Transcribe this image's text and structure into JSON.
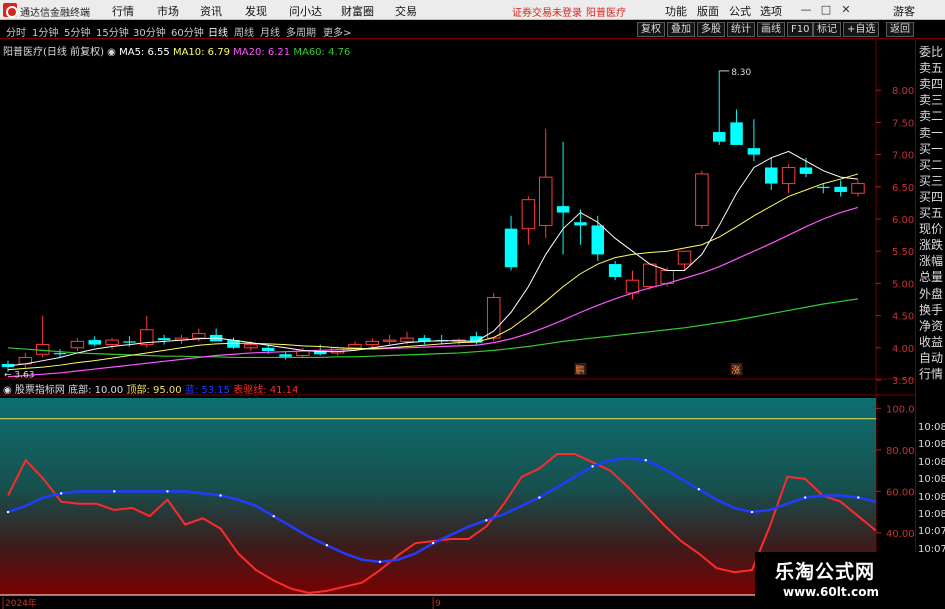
{
  "app": {
    "name": "通达信金融终端"
  },
  "menu": [
    "行情",
    "市场",
    "资讯",
    "发现",
    "问小达",
    "财富圈",
    "交易"
  ],
  "notice": {
    "login": "证券交易未登录",
    "stock": "阳普医疗"
  },
  "right_tools": [
    "功能",
    "版面",
    "公式",
    "选项"
  ],
  "window": {
    "min": "—",
    "max": "□",
    "close": "✕",
    "extra": "游客"
  },
  "periods": [
    "分时",
    "1分钟",
    "5分钟",
    "15分钟",
    "30分钟",
    "60分钟",
    "日线",
    "周线",
    "月线",
    "多周期",
    "更多>"
  ],
  "active_period": "日线",
  "tools": [
    "复权",
    "叠加",
    "多股",
    "统计",
    "画线",
    "F10",
    "标记",
    "+自选",
    "返回"
  ],
  "main_legend": {
    "title": "阳普医疗(日线 前复权)",
    "ma5": "MA5: 6.55",
    "ma10": "MA10: 6.79",
    "ma20": "MA20: 6.21",
    "ma60": "MA60: 4.76"
  },
  "indicator_legend": {
    "name": "股票指标网",
    "bottom": "底部: 10.00",
    "top": "顶部: 95.00",
    "blue": "蓝: 53.15",
    "red": "表驱线: 41.14"
  },
  "price_axis": [
    "8.00",
    "7.50",
    "7.00",
    "6.50",
    "6.00",
    "5.50",
    "5.00",
    "4.50",
    "4.00",
    "3.50"
  ],
  "indicator_axis": [
    "100.0",
    "80.00",
    "60.00",
    "40.00"
  ],
  "annotations": {
    "high": "8.30",
    "low": "3.63",
    "mark1": "鹏",
    "mark2": "涨"
  },
  "dates": {
    "d1": "2024年",
    "d2": "9",
    "d3": "10"
  },
  "side_panel": [
    "委比",
    "卖五",
    "卖四",
    "卖三",
    "卖二",
    "卖一",
    "买一",
    "买二",
    "买三",
    "买四",
    "买五",
    "现价",
    "涨跌",
    "涨幅",
    "总量",
    "外盘",
    "换手",
    "净资",
    "收益",
    "自动",
    "行情"
  ],
  "side_times": [
    "10:08",
    "10:08",
    "10:08",
    "10:08",
    "10:08",
    "10:08",
    "10:07",
    "10:07",
    "10:07"
  ],
  "watermark": {
    "title": "乐淘公式网",
    "url": "www.60lt.com"
  },
  "colors": {
    "up": "#ff3c3c",
    "down": "#00ffff",
    "ma5": "#ffffff",
    "ma10": "#ffff66",
    "ma20": "#ff55ff",
    "ma60": "#33cc33",
    "blue_line": "#1f3cff",
    "red_line": "#ff2a2a",
    "yellow_line": "#f0e060"
  },
  "chart_data": {
    "type": "candlestick",
    "ylim": [
      3.5,
      8.5
    ],
    "candles": [
      {
        "o": 3.75,
        "h": 3.8,
        "l": 3.63,
        "c": 3.7
      },
      {
        "o": 3.75,
        "h": 3.92,
        "l": 3.68,
        "c": 3.85
      },
      {
        "o": 3.9,
        "h": 4.5,
        "l": 3.85,
        "c": 4.05
      },
      {
        "o": 3.92,
        "h": 3.98,
        "l": 3.85,
        "c": 3.9
      },
      {
        "o": 4.0,
        "h": 4.15,
        "l": 3.95,
        "c": 4.1
      },
      {
        "o": 4.12,
        "h": 4.18,
        "l": 4.02,
        "c": 4.05
      },
      {
        "o": 4.05,
        "h": 4.15,
        "l": 3.98,
        "c": 4.12
      },
      {
        "o": 4.1,
        "h": 4.18,
        "l": 4.02,
        "c": 4.08
      },
      {
        "o": 4.05,
        "h": 4.5,
        "l": 4.0,
        "c": 4.28
      },
      {
        "o": 4.15,
        "h": 4.2,
        "l": 4.05,
        "c": 4.12
      },
      {
        "o": 4.12,
        "h": 4.2,
        "l": 4.06,
        "c": 4.15
      },
      {
        "o": 4.15,
        "h": 4.3,
        "l": 4.1,
        "c": 4.22
      },
      {
        "o": 4.2,
        "h": 4.3,
        "l": 4.1,
        "c": 4.1
      },
      {
        "o": 4.12,
        "h": 4.16,
        "l": 3.98,
        "c": 4.0
      },
      {
        "o": 4.0,
        "h": 4.1,
        "l": 3.95,
        "c": 4.05
      },
      {
        "o": 4.0,
        "h": 4.05,
        "l": 3.9,
        "c": 3.95
      },
      {
        "o": 3.9,
        "h": 3.95,
        "l": 3.82,
        "c": 3.86
      },
      {
        "o": 3.88,
        "h": 4.0,
        "l": 3.84,
        "c": 3.95
      },
      {
        "o": 3.95,
        "h": 4.05,
        "l": 3.88,
        "c": 3.9
      },
      {
        "o": 3.92,
        "h": 4.02,
        "l": 3.88,
        "c": 4.0
      },
      {
        "o": 4.0,
        "h": 4.1,
        "l": 3.95,
        "c": 4.05
      },
      {
        "o": 4.05,
        "h": 4.15,
        "l": 4.0,
        "c": 4.1
      },
      {
        "o": 4.1,
        "h": 4.2,
        "l": 4.05,
        "c": 4.12
      },
      {
        "o": 4.1,
        "h": 4.25,
        "l": 4.05,
        "c": 4.15
      },
      {
        "o": 4.15,
        "h": 4.2,
        "l": 4.05,
        "c": 4.1
      },
      {
        "o": 4.12,
        "h": 4.2,
        "l": 4.05,
        "c": 4.1
      },
      {
        "o": 4.1,
        "h": 4.15,
        "l": 4.05,
        "c": 4.12
      },
      {
        "o": 4.18,
        "h": 4.25,
        "l": 4.05,
        "c": 4.08
      },
      {
        "o": 4.15,
        "h": 4.85,
        "l": 4.1,
        "c": 4.78
      },
      {
        "o": 5.85,
        "h": 6.05,
        "l": 5.2,
        "c": 5.25
      },
      {
        "o": 5.85,
        "h": 6.35,
        "l": 5.6,
        "c": 6.3
      },
      {
        "o": 5.9,
        "h": 7.4,
        "l": 5.7,
        "c": 6.65
      },
      {
        "o": 6.2,
        "h": 7.2,
        "l": 5.45,
        "c": 6.1
      },
      {
        "o": 5.95,
        "h": 6.15,
        "l": 5.6,
        "c": 5.9
      },
      {
        "o": 5.9,
        "h": 6.05,
        "l": 5.35,
        "c": 5.45
      },
      {
        "o": 5.3,
        "h": 5.35,
        "l": 5.05,
        "c": 5.1
      },
      {
        "o": 4.85,
        "h": 5.2,
        "l": 4.75,
        "c": 5.05
      },
      {
        "o": 4.95,
        "h": 5.3,
        "l": 4.9,
        "c": 5.3
      },
      {
        "o": 5.0,
        "h": 5.25,
        "l": 4.95,
        "c": 5.2
      },
      {
        "o": 5.3,
        "h": 5.5,
        "l": 5.2,
        "c": 5.5
      },
      {
        "o": 5.9,
        "h": 6.75,
        "l": 5.85,
        "c": 6.7
      },
      {
        "o": 7.35,
        "h": 8.3,
        "l": 7.15,
        "c": 7.2
      },
      {
        "o": 7.5,
        "h": 7.7,
        "l": 7.15,
        "c": 7.15
      },
      {
        "o": 7.1,
        "h": 7.55,
        "l": 6.9,
        "c": 7.0
      },
      {
        "o": 6.8,
        "h": 6.95,
        "l": 6.45,
        "c": 6.55
      },
      {
        "o": 6.55,
        "h": 6.85,
        "l": 6.4,
        "c": 6.8
      },
      {
        "o": 6.8,
        "h": 6.95,
        "l": 6.65,
        "c": 6.7
      },
      {
        "o": 6.5,
        "h": 6.55,
        "l": 6.4,
        "c": 6.48
      },
      {
        "o": 6.5,
        "h": 6.6,
        "l": 6.35,
        "c": 6.42
      },
      {
        "o": 6.4,
        "h": 6.6,
        "l": 6.35,
        "c": 6.55
      }
    ],
    "ma5": [
      3.72,
      3.75,
      3.8,
      3.85,
      3.92,
      3.98,
      4.02,
      4.05,
      4.08,
      4.1,
      4.12,
      4.14,
      4.15,
      4.12,
      4.08,
      4.04,
      4.0,
      3.96,
      3.94,
      3.94,
      3.96,
      4.0,
      4.04,
      4.08,
      4.1,
      4.11,
      4.11,
      4.1,
      4.26,
      4.55,
      4.95,
      5.45,
      5.85,
      6.1,
      5.95,
      5.7,
      5.5,
      5.3,
      5.2,
      5.2,
      5.45,
      5.9,
      6.4,
      6.8,
      6.95,
      7.05,
      6.9,
      6.75,
      6.65,
      6.62
    ],
    "ma10": [
      3.66,
      3.68,
      3.7,
      3.73,
      3.77,
      3.8,
      3.84,
      3.88,
      3.92,
      3.96,
      4.0,
      4.04,
      4.06,
      4.07,
      4.07,
      4.06,
      4.05,
      4.03,
      4.02,
      4.0,
      3.99,
      3.99,
      4.0,
      4.02,
      4.04,
      4.06,
      4.08,
      4.09,
      4.16,
      4.3,
      4.5,
      4.72,
      4.95,
      5.15,
      5.3,
      5.4,
      5.45,
      5.48,
      5.5,
      5.55,
      5.6,
      5.72,
      5.88,
      6.05,
      6.2,
      6.35,
      6.45,
      6.55,
      6.62,
      6.7
    ],
    "ma20": [
      3.55,
      3.57,
      3.59,
      3.61,
      3.64,
      3.67,
      3.7,
      3.73,
      3.76,
      3.79,
      3.82,
      3.85,
      3.88,
      3.9,
      3.92,
      3.93,
      3.94,
      3.95,
      3.96,
      3.97,
      3.98,
      3.98,
      3.99,
      4.0,
      4.01,
      4.02,
      4.03,
      4.04,
      4.08,
      4.14,
      4.22,
      4.32,
      4.43,
      4.55,
      4.66,
      4.76,
      4.85,
      4.93,
      5.0,
      5.08,
      5.16,
      5.26,
      5.38,
      5.5,
      5.62,
      5.75,
      5.88,
      6.0,
      6.1,
      6.18
    ],
    "ma60": [
      4.0,
      3.98,
      3.96,
      3.94,
      3.92,
      3.91,
      3.9,
      3.89,
      3.88,
      3.87,
      3.87,
      3.86,
      3.86,
      3.85,
      3.85,
      3.85,
      3.85,
      3.85,
      3.85,
      3.86,
      3.86,
      3.87,
      3.88,
      3.89,
      3.9,
      3.91,
      3.92,
      3.94,
      3.96,
      3.99,
      4.02,
      4.06,
      4.1,
      4.13,
      4.16,
      4.19,
      4.22,
      4.25,
      4.28,
      4.31,
      4.35,
      4.39,
      4.43,
      4.48,
      4.53,
      4.58,
      4.63,
      4.68,
      4.72,
      4.76
    ],
    "indicator": {
      "ylim": [
        10,
        105
      ],
      "bottom": 10,
      "top": 95,
      "blue": [
        50,
        53,
        57,
        59,
        60,
        60,
        60,
        60,
        60,
        60,
        60,
        59,
        58,
        56,
        53,
        48,
        43,
        38,
        34,
        30,
        27,
        26,
        27,
        30,
        35,
        39,
        43,
        46,
        49,
        53,
        57,
        62,
        67,
        72,
        75,
        76,
        75,
        71,
        66,
        61,
        56,
        52,
        50,
        51,
        54,
        57,
        58,
        58,
        57,
        55
      ],
      "red": [
        58,
        75,
        66,
        55,
        54,
        54,
        51,
        52,
        48,
        56,
        44,
        47,
        42,
        30,
        22,
        17,
        13,
        11,
        12,
        14,
        16,
        22,
        29,
        35,
        36,
        37,
        37,
        43,
        54,
        67,
        71,
        78,
        78,
        74,
        70,
        62,
        53,
        44,
        36,
        30,
        23,
        21,
        22,
        43,
        67,
        66,
        58,
        55,
        48,
        41
      ]
    }
  }
}
